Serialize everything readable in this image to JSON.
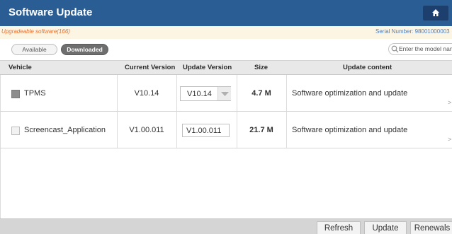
{
  "window": {
    "title": "Software Update"
  },
  "info": {
    "upgradeable": "Upgradeable software(166)",
    "serial_label": "Serial Number:",
    "serial_value": "98001000003"
  },
  "filters": {
    "available_label": "Available",
    "downloaded_label": "Downloaded",
    "search_placeholder": "Enter the model name"
  },
  "table": {
    "columns": [
      "Vehicle",
      "Current Version",
      "Update Version",
      "Size",
      "Update content"
    ],
    "rows": [
      {
        "checked": true,
        "vehicle": "TPMS",
        "current_version": "V10.14",
        "update_version": "V10.14",
        "size": "4.7 M",
        "content": "Software optimization and update"
      },
      {
        "checked": false,
        "vehicle": "Screencast_Application",
        "current_version": "V1.00.011",
        "update_version": "V1.00.011",
        "size": "21.7 M",
        "content": "Software optimization and update"
      }
    ]
  },
  "footer": {
    "refresh": "Refresh",
    "update": "Update",
    "renewals": "Renewals"
  },
  "colors": {
    "titlebar": "#2a5d93",
    "home_button": "#1d3f6e",
    "info_strip": "#fdf5e4",
    "upgradeable_text": "#e86f2a",
    "serial_text": "#4d7fbe",
    "downloaded_pill": "#6e6e6e"
  },
  "icons": {
    "home": "home-icon",
    "search": "search-icon",
    "dropdown": "chevron-down-icon"
  }
}
